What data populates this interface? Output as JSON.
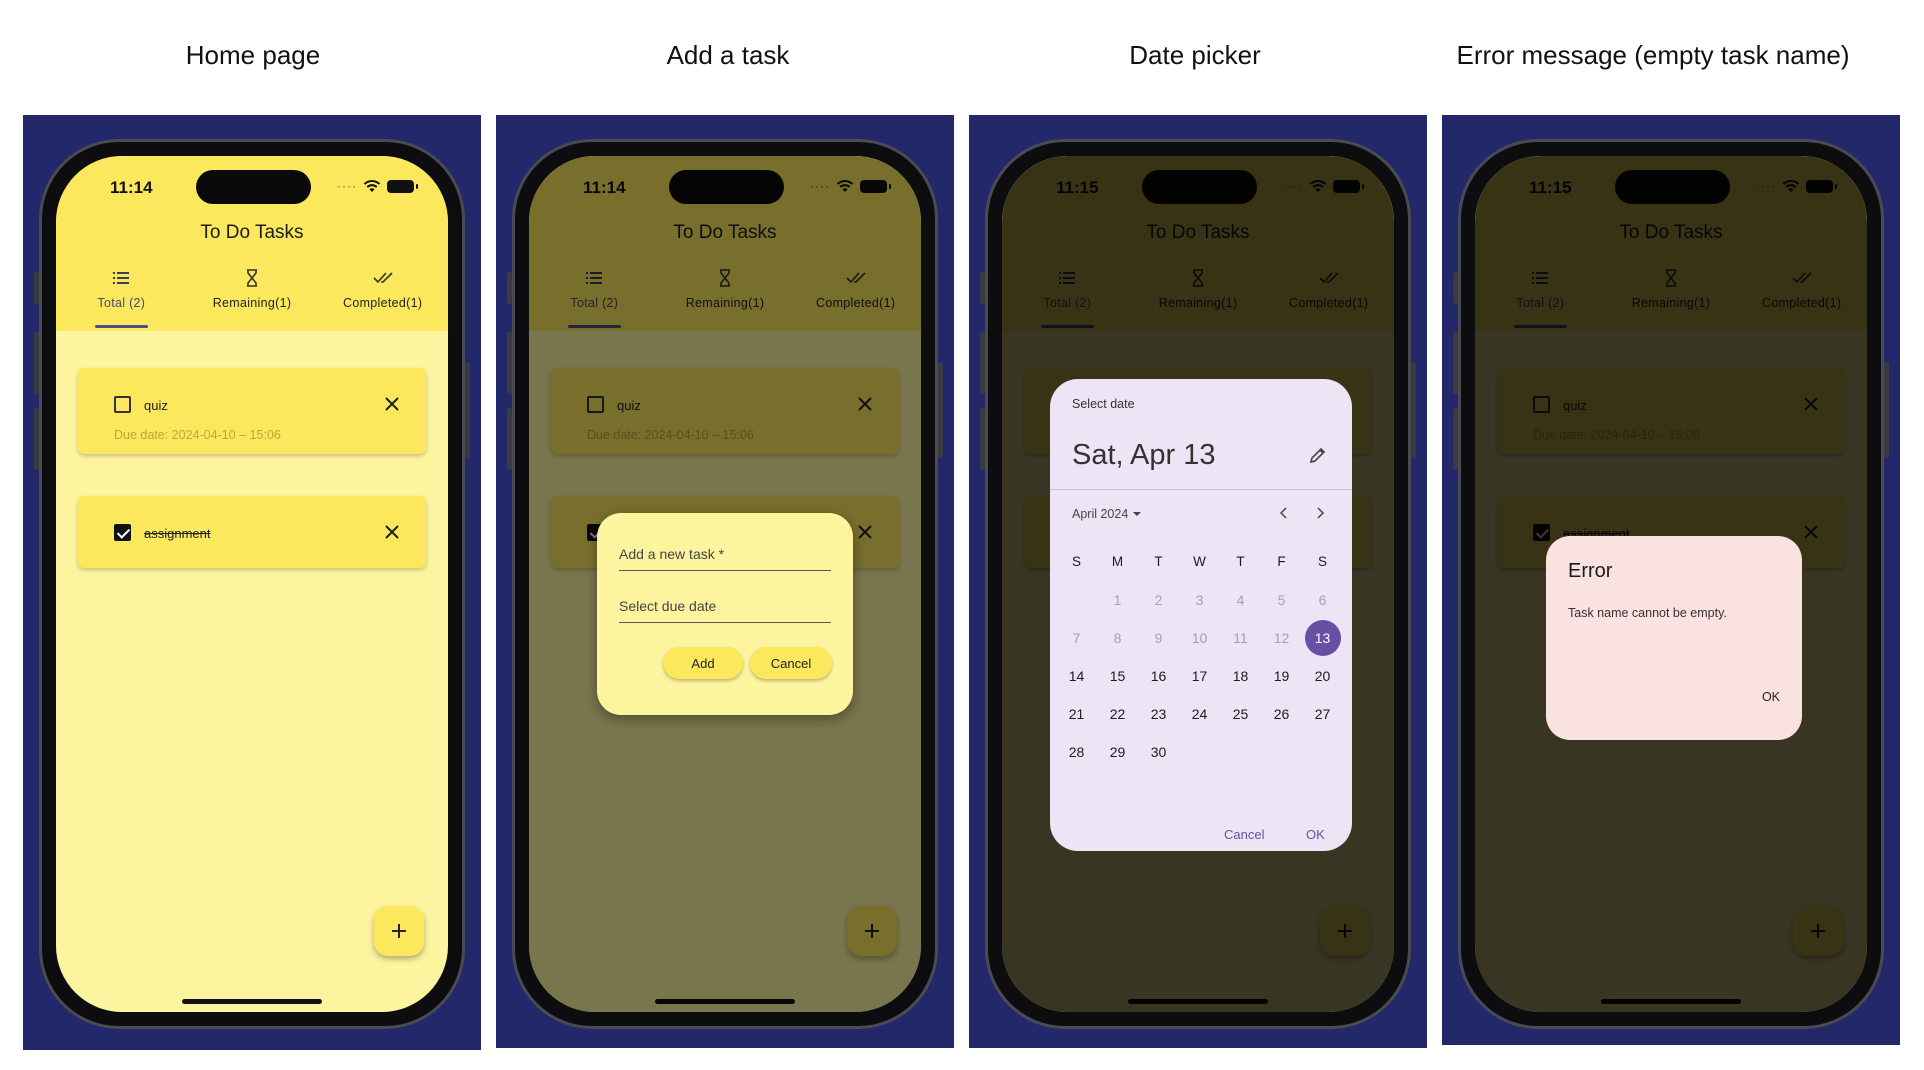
{
  "captions": [
    "Home page",
    "Add a task",
    "Date picker",
    "Error message (empty task name)"
  ],
  "phones": [
    {
      "time": "11:14"
    },
    {
      "time": "11:14"
    },
    {
      "time": "11:15"
    },
    {
      "time": "11:15"
    }
  ],
  "app": {
    "title": "To Do Tasks",
    "tabs": [
      {
        "label": "Total (2)",
        "icon": "list-icon"
      },
      {
        "label": "Remaining(1)",
        "icon": "hourglass-icon"
      },
      {
        "label": "Completed(1)",
        "icon": "double-check-icon"
      }
    ],
    "tasks": [
      {
        "name": "quiz",
        "due": "Due date: 2024-04-10 – 15:06",
        "completed": false
      },
      {
        "name": "assignment",
        "completed": true
      }
    ],
    "fab_icon": "plus-icon"
  },
  "add_dialog": {
    "task_label": "Add a new task *",
    "date_label": "Select due date",
    "add": "Add",
    "cancel": "Cancel"
  },
  "date_picker": {
    "header": "Select date",
    "selected_text": "Sat, Apr 13",
    "month": "April 2024",
    "weekdays": [
      "S",
      "M",
      "T",
      "W",
      "T",
      "F",
      "S"
    ],
    "weeks": [
      [
        "",
        "1",
        "2",
        "3",
        "4",
        "5",
        "6"
      ],
      [
        "7",
        "8",
        "9",
        "10",
        "11",
        "12",
        "13"
      ],
      [
        "14",
        "15",
        "16",
        "17",
        "18",
        "19",
        "20"
      ],
      [
        "21",
        "22",
        "23",
        "24",
        "25",
        "26",
        "27"
      ],
      [
        "28",
        "29",
        "30",
        "",
        "",
        "",
        ""
      ]
    ],
    "selected_day": "13",
    "cancel": "Cancel",
    "ok": "OK"
  },
  "error_dialog": {
    "title": "Error",
    "message": "Task name cannot be empty.",
    "ok": "OK"
  },
  "colors": {
    "background": "#22286a",
    "appbar": "#fbe85c",
    "body": "#fdf4a0",
    "accent": "#6750a4",
    "error_dialog": "#fae2e0",
    "picker": "#ede4f6"
  }
}
